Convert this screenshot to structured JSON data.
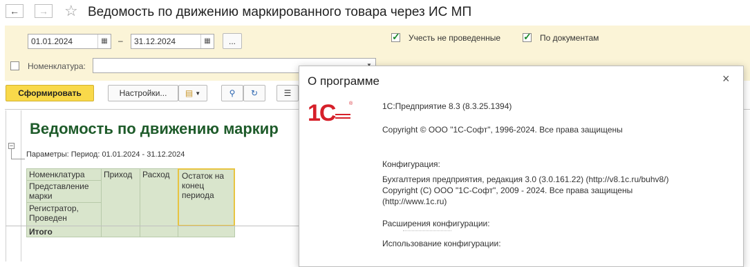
{
  "window": {
    "title": "Ведомость по движению маркированного товара через ИС МП",
    "back_label": "←",
    "forward_label": "→",
    "favorite_label": "☆"
  },
  "params": {
    "date_from": "01.01.2024",
    "date_to": "31.12.2024",
    "dash": "–",
    "more_label": "...",
    "unposted_label": "Учесть не проведенные",
    "unposted_checked": true,
    "by_docs_label": "По документам",
    "by_docs_checked": true,
    "nomenclature_label": "Номенклатура:",
    "nomenclature_value": ""
  },
  "toolbar": {
    "generate_label": "Сформировать",
    "settings_label": "Настройки..."
  },
  "report": {
    "title": "Ведомость по движению маркир",
    "params_line": "Параметры: Период: 01.01.2024 - 31.12.2024",
    "col_nomenclature": "Номенклатура",
    "col_mark": "Представление марки",
    "col_registrar": "Регистратор, Проведен",
    "col_in": "Приход",
    "col_out": "Расход",
    "col_balance": "Остаток на конец периода",
    "total_label": "Итого"
  },
  "dialog": {
    "title": "О программе",
    "logo_text": "1С",
    "platform": "1С:Предприятие 8.3 (8.3.25.1394)",
    "copyright": "Copyright © ООО \"1С-Софт\", 1996-2024. Все права защищены",
    "config_header": "Конфигурация:",
    "config_name": "Бухгалтерия предприятия, редакция 3.0 (3.0.161.22) (http://v8.1c.ru/buhv8/)",
    "config_copyright": "Copyright (C) ООО \"1С-Софт\", 2009 - 2024. Все права защищены",
    "config_url": "(http://www.1c.ru)",
    "extensions_header": "Расширения конфигурации:",
    "usage_header": "Использование конфигурации:"
  }
}
